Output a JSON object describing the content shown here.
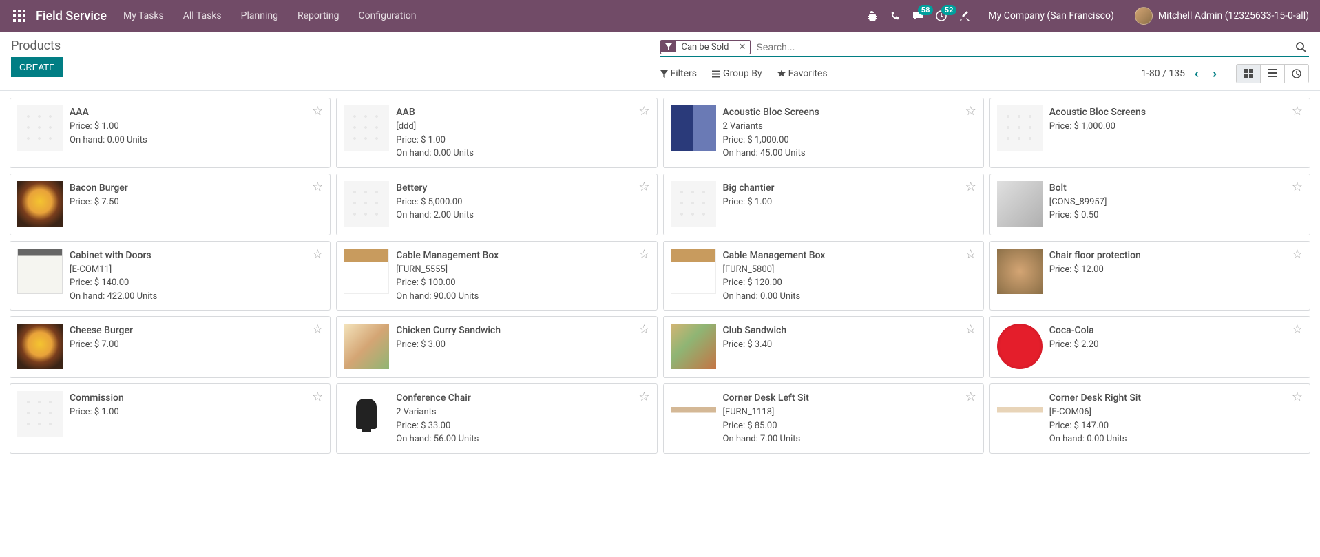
{
  "navbar": {
    "app_title": "Field Service",
    "links": [
      "My Tasks",
      "All Tasks",
      "Planning",
      "Reporting",
      "Configuration"
    ],
    "msg_badge": "58",
    "activity_badge": "52",
    "company": "My Company (San Francisco)",
    "user": "Mitchell Admin (12325633-15-0-all)"
  },
  "cp": {
    "breadcrumb": "Products",
    "create_btn": "Create",
    "filter": {
      "label": "Can be Sold"
    },
    "search_placeholder": "Search...",
    "opts": {
      "filters": "Filters",
      "groupby": "Group By",
      "favorites": "Favorites"
    },
    "pager": "1-80 / 135"
  },
  "products": [
    {
      "name": "AAA",
      "ref": "",
      "variants": "",
      "price": "Price: $ 1.00",
      "onhand": "On hand: 0.00 Units",
      "thumb": "placeholder"
    },
    {
      "name": "AAB",
      "ref": "[ddd]",
      "variants": "",
      "price": "Price: $ 1.00",
      "onhand": "On hand: 0.00 Units",
      "thumb": "placeholder"
    },
    {
      "name": "Acoustic Bloc Screens",
      "ref": "",
      "variants": "2 Variants",
      "price": "Price: $ 1,000.00",
      "onhand": "On hand: 45.00 Units",
      "thumb": "blue-screen"
    },
    {
      "name": "Acoustic Bloc Screens",
      "ref": "",
      "variants": "",
      "price": "Price: $ 1,000.00",
      "onhand": "",
      "thumb": "placeholder"
    },
    {
      "name": "Bacon Burger",
      "ref": "",
      "variants": "",
      "price": "Price: $ 7.50",
      "onhand": "",
      "thumb": "burger"
    },
    {
      "name": "Bettery",
      "ref": "",
      "variants": "",
      "price": "Price: $ 5,000.00",
      "onhand": "On hand: 2.00 Units",
      "thumb": "placeholder"
    },
    {
      "name": "Big chantier",
      "ref": "",
      "variants": "",
      "price": "Price: $ 1.00",
      "onhand": "",
      "thumb": "placeholder"
    },
    {
      "name": "Bolt",
      "ref": "[CONS_89957]",
      "variants": "",
      "price": "Price: $ 0.50",
      "onhand": "",
      "thumb": "bolt"
    },
    {
      "name": "Cabinet with Doors",
      "ref": "[E-COM11]",
      "variants": "",
      "price": "Price: $ 140.00",
      "onhand": "On hand: 422.00 Units",
      "thumb": "cabinet"
    },
    {
      "name": "Cable Management Box",
      "ref": "[FURN_5555]",
      "variants": "",
      "price": "Price: $ 100.00",
      "onhand": "On hand: 90.00 Units",
      "thumb": "box-wood"
    },
    {
      "name": "Cable Management Box",
      "ref": "[FURN_5800]",
      "variants": "",
      "price": "Price: $ 120.00",
      "onhand": "On hand: 0.00 Units",
      "thumb": "box-wood"
    },
    {
      "name": "Chair floor protection",
      "ref": "",
      "variants": "",
      "price": "Price: $ 12.00",
      "onhand": "",
      "thumb": "chair-mat"
    },
    {
      "name": "Cheese Burger",
      "ref": "",
      "variants": "",
      "price": "Price: $ 7.00",
      "onhand": "",
      "thumb": "burger"
    },
    {
      "name": "Chicken Curry Sandwich",
      "ref": "",
      "variants": "",
      "price": "Price: $ 3.00",
      "onhand": "",
      "thumb": "sandwich"
    },
    {
      "name": "Club Sandwich",
      "ref": "",
      "variants": "",
      "price": "Price: $ 3.40",
      "onhand": "",
      "thumb": "club"
    },
    {
      "name": "Coca-Cola",
      "ref": "",
      "variants": "",
      "price": "Price: $ 2.20",
      "onhand": "",
      "thumb": "coke"
    },
    {
      "name": "Commission",
      "ref": "",
      "variants": "",
      "price": "Price: $ 1.00",
      "onhand": "",
      "thumb": "placeholder"
    },
    {
      "name": "Conference Chair",
      "ref": "",
      "variants": "2 Variants",
      "price": "Price: $ 33.00",
      "onhand": "On hand: 56.00 Units",
      "thumb": "chair"
    },
    {
      "name": "Corner Desk Left Sit",
      "ref": "[FURN_1118]",
      "variants": "",
      "price": "Price: $ 85.00",
      "onhand": "On hand: 7.00 Units",
      "thumb": "desk-l"
    },
    {
      "name": "Corner Desk Right Sit",
      "ref": "[E-COM06]",
      "variants": "",
      "price": "Price: $ 147.00",
      "onhand": "On hand: 0.00 Units",
      "thumb": "desk-r"
    }
  ]
}
